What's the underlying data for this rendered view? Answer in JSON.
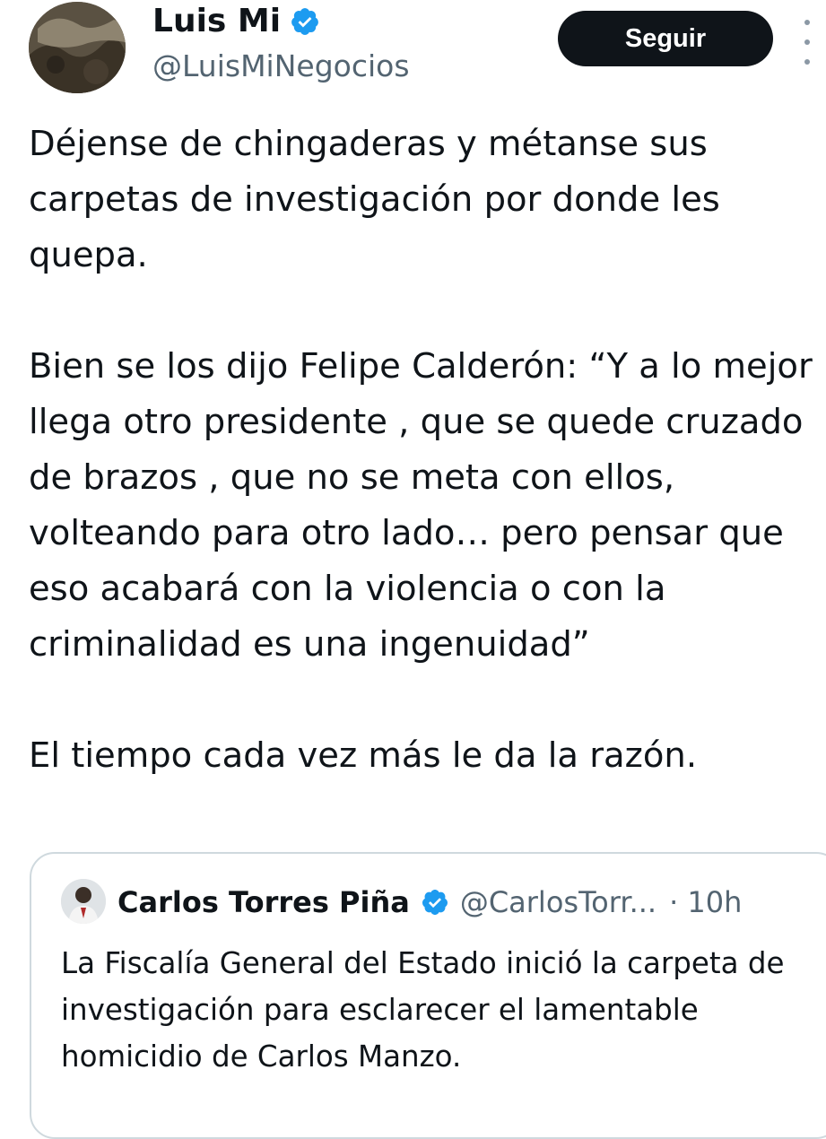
{
  "author": {
    "display_name": "Luis Mi",
    "handle": "@LuisMiNegocios",
    "verified": true,
    "avatar_icon": "avatar-photo"
  },
  "actions": {
    "follow_label": "Seguir",
    "more_icon": "more-vertical-icon"
  },
  "tweet": {
    "paragraphs": [
      "Déjense de chingaderas y métanse sus carpetas de investigación por donde les quepa.",
      "Bien se los dijo Felipe Calderón: “Y a lo mejor llega otro presidente , que se quede cruzado de brazos , que no se meta con ellos, volteando para otro lado… pero pensar que eso acabará con la violencia o con la criminalidad es una ingenuidad”",
      "El tiempo cada vez más le da la razón."
    ]
  },
  "quoted": {
    "display_name": "Carlos Torres Piña",
    "handle": "@CarlosTorr...",
    "time": "· 10h",
    "verified": true,
    "text": "La Fiscalía General del Estado inició la carpeta de investigación para esclarecer el lamentable homicidio de Carlos Manzo."
  },
  "colors": {
    "text": "#0f1419",
    "secondary": "#536471",
    "verified_blue": "#1d9bf0",
    "button_bg": "#0f1419",
    "border": "#cfd9de"
  }
}
